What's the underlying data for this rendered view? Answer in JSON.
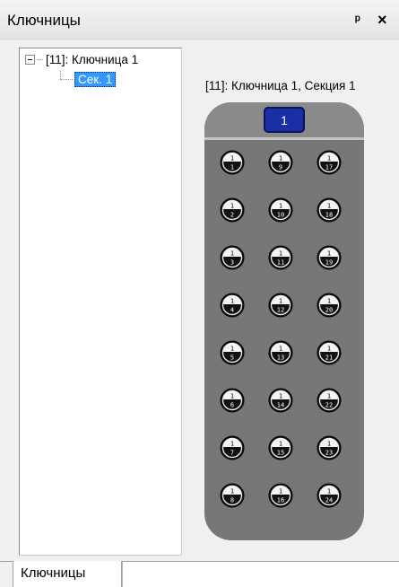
{
  "panel": {
    "title": "Ключницы",
    "pin_glyph": "⫯",
    "close_glyph": "×"
  },
  "tree": {
    "root_label": "[11]: Ключница 1",
    "child_label": "Сек. 1"
  },
  "section": {
    "label": "[11]: Ключница 1, Секция 1",
    "badge": "1"
  },
  "keys": [
    {
      "top": "1",
      "num": "1"
    },
    {
      "top": "1",
      "num": "9"
    },
    {
      "top": "1",
      "num": "17"
    },
    {
      "top": "1",
      "num": "2"
    },
    {
      "top": "1",
      "num": "10"
    },
    {
      "top": "1",
      "num": "18"
    },
    {
      "top": "1",
      "num": "3"
    },
    {
      "top": "1",
      "num": "11"
    },
    {
      "top": "1",
      "num": "19"
    },
    {
      "top": "1",
      "num": "4"
    },
    {
      "top": "1",
      "num": "12"
    },
    {
      "top": "1",
      "num": "20"
    },
    {
      "top": "1",
      "num": "5"
    },
    {
      "top": "1",
      "num": "13"
    },
    {
      "top": "1",
      "num": "21"
    },
    {
      "top": "1",
      "num": "6"
    },
    {
      "top": "1",
      "num": "14"
    },
    {
      "top": "1",
      "num": "22"
    },
    {
      "top": "1",
      "num": "7"
    },
    {
      "top": "1",
      "num": "15"
    },
    {
      "top": "1",
      "num": "23"
    },
    {
      "top": "1",
      "num": "8"
    },
    {
      "top": "1",
      "num": "16"
    },
    {
      "top": "1",
      "num": "24"
    }
  ],
  "tabs": {
    "active_label": "Ключницы"
  },
  "colors": {
    "selection": "#3399ff",
    "badge": "#1a2fa6",
    "keyholder_body": "#777777"
  }
}
